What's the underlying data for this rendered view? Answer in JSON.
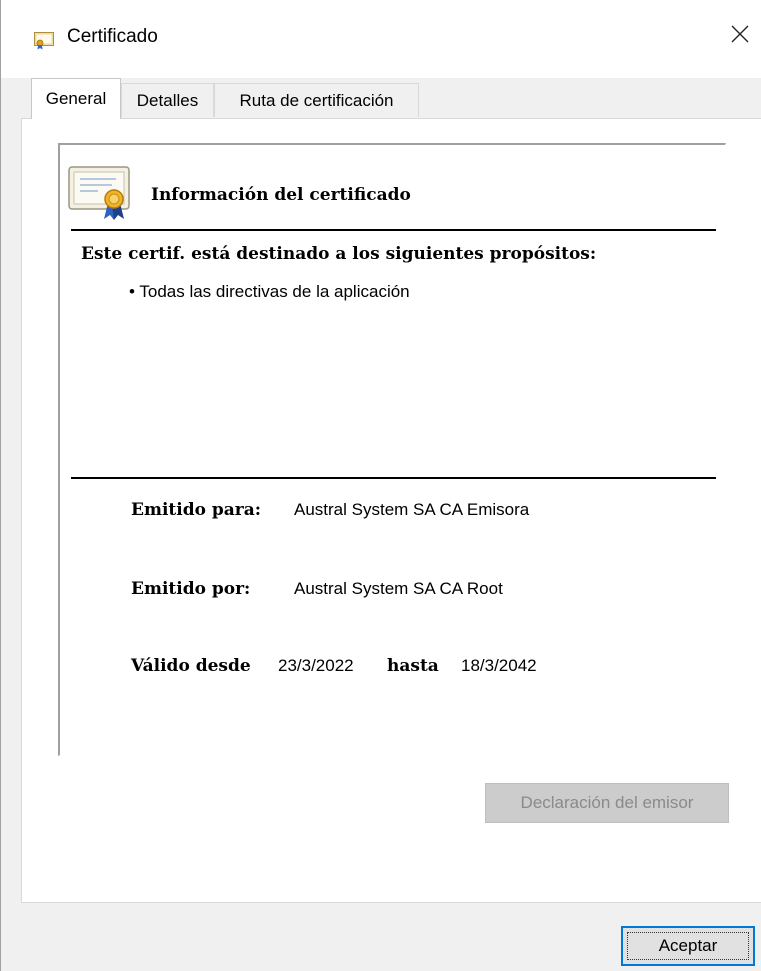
{
  "window": {
    "title": "Certificado",
    "title_icon": "certificate-icon",
    "close_icon": "close-icon"
  },
  "tabs": [
    {
      "label": "General",
      "active": true
    },
    {
      "label": "Detalles",
      "active": false
    },
    {
      "label": "Ruta de certificación",
      "active": false
    }
  ],
  "general": {
    "info_icon": "certificate-ribbon-icon",
    "heading": "Información del certificado",
    "purpose_heading": "Este certif. está destinado a los siguientes propósitos:",
    "purposes": [
      "• Todas las directivas de la aplicación"
    ],
    "issued_to_label": "Emitido para:",
    "issued_to_value": "Austral System SA CA Emisora",
    "issued_by_label": "Emitido por:",
    "issued_by_value": "Austral System SA CA Root",
    "valid_from_label": "Válido desde",
    "valid_from_value": "23/3/2022",
    "valid_to_label": "hasta",
    "valid_to_value": "18/3/2042",
    "issuer_statement_button": "Declaración del emisor"
  },
  "footer": {
    "ok_button": "Aceptar"
  },
  "colors": {
    "accent": "#0078d7",
    "disabled_button_bg": "#cccccc",
    "disabled_button_text": "#8a8a8a"
  }
}
